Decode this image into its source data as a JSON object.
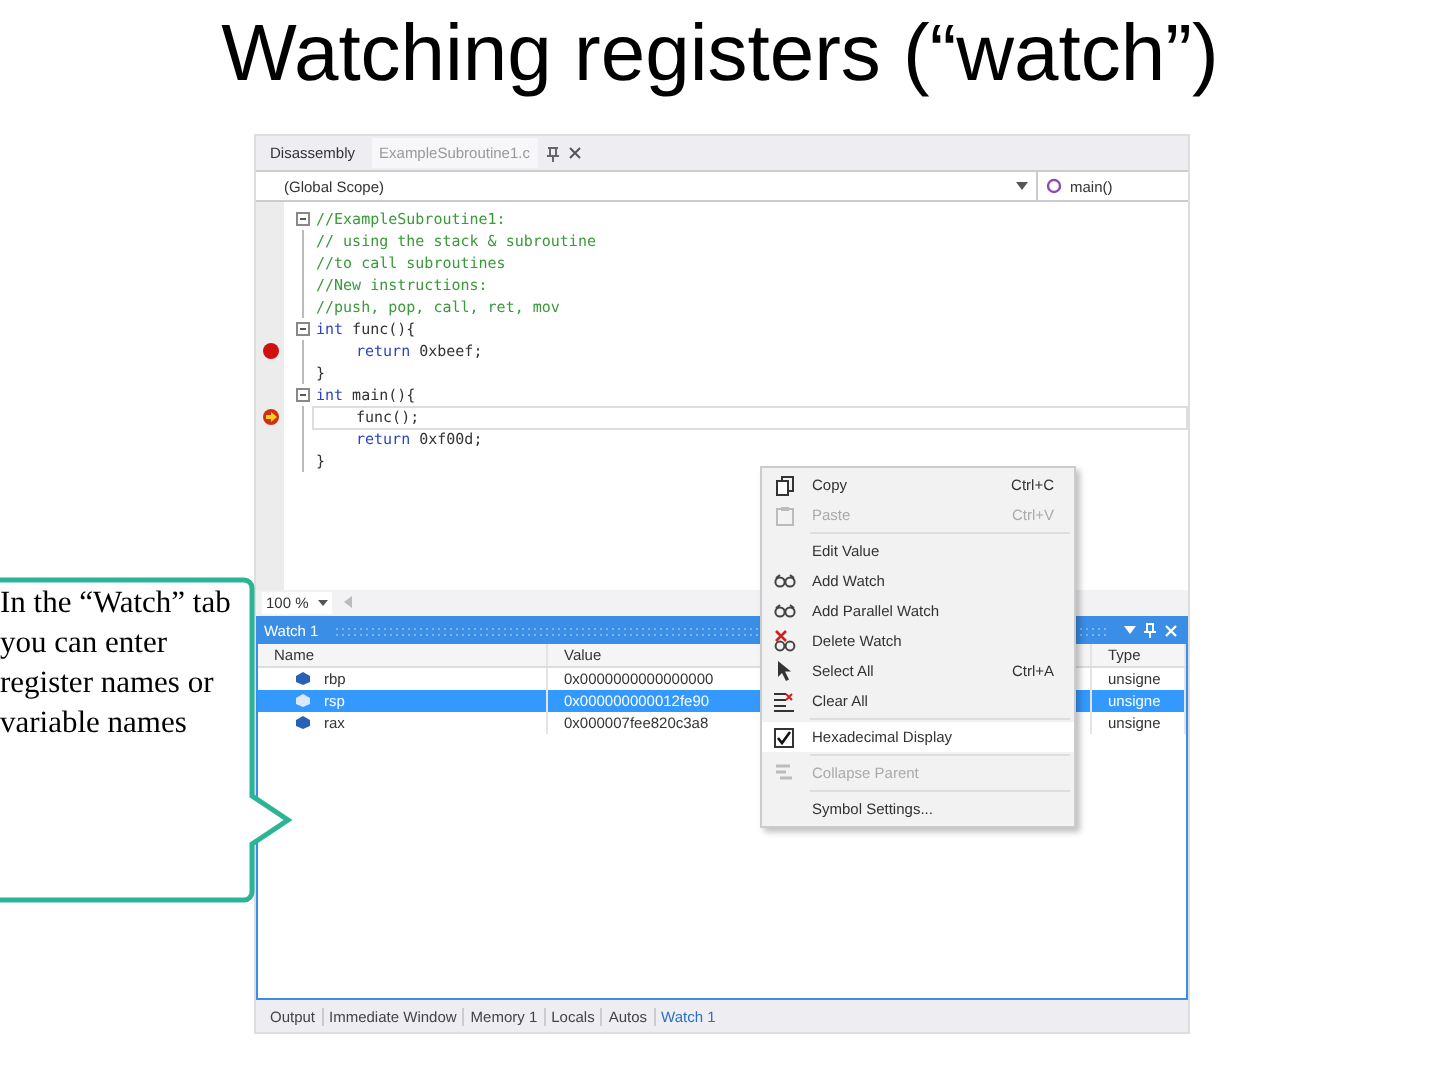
{
  "slide": {
    "title": "Watching registers (“watch”)"
  },
  "callout": {
    "text": "In the “Watch” tab you can enter register names or variable names"
  },
  "editor": {
    "tabs": [
      {
        "label": "Disassembly",
        "selected": false
      },
      {
        "label": "ExampleSubroutine1.c",
        "selected": true
      }
    ],
    "scope": "(Global Scope)",
    "member": "main()",
    "zoom": "100 %",
    "lines": [
      {
        "fold": true,
        "current": false,
        "tokens": [
          {
            "kind": "comment",
            "text": "//ExampleSubroutine1:"
          }
        ]
      },
      {
        "fold": false,
        "current": false,
        "tokens": [
          {
            "kind": "comment",
            "text": "// using the stack & subroutine"
          }
        ]
      },
      {
        "fold": false,
        "current": false,
        "tokens": [
          {
            "kind": "comment",
            "text": "//to call subroutines"
          }
        ]
      },
      {
        "fold": false,
        "current": false,
        "tokens": [
          {
            "kind": "comment",
            "text": "//New instructions:"
          }
        ]
      },
      {
        "fold": false,
        "current": false,
        "tokens": [
          {
            "kind": "comment",
            "text": "//push, pop, call, ret, mov"
          }
        ]
      },
      {
        "fold": true,
        "current": false,
        "tokens": [
          {
            "kind": "keyword",
            "text": "int"
          },
          {
            "kind": "plain",
            "text": " func(){"
          }
        ]
      },
      {
        "fold": false,
        "current": false,
        "breakpoint": true,
        "indented": true,
        "tokens": [
          {
            "kind": "keyword",
            "text": "return"
          },
          {
            "kind": "plain",
            "text": " 0xbeef;"
          }
        ]
      },
      {
        "fold": false,
        "current": false,
        "tokens": [
          {
            "kind": "plain",
            "text": "}"
          }
        ]
      },
      {
        "fold": true,
        "current": false,
        "tokens": [
          {
            "kind": "keyword",
            "text": "int"
          },
          {
            "kind": "plain",
            "text": " main(){"
          }
        ]
      },
      {
        "fold": false,
        "current": true,
        "breakpoint": true,
        "indented": true,
        "tokens": [
          {
            "kind": "plain",
            "text": "func();"
          }
        ]
      },
      {
        "fold": false,
        "current": false,
        "indented": true,
        "tokens": [
          {
            "kind": "keyword",
            "text": "return"
          },
          {
            "kind": "plain",
            "text": " 0xf00d;"
          }
        ]
      },
      {
        "fold": false,
        "current": false,
        "tokens": [
          {
            "kind": "plain",
            "text": "}"
          }
        ]
      }
    ]
  },
  "watch": {
    "title": "Watch 1",
    "columns": [
      "Name",
      "Value",
      "Type"
    ],
    "rows": [
      {
        "name": "rbp",
        "value": "0x0000000000000000",
        "type": "unsigne",
        "selected": false
      },
      {
        "name": "rsp",
        "value": "0x000000000012fe90",
        "type": "unsigne",
        "selected": true
      },
      {
        "name": "rax",
        "value": "0x000007fee820c3a8",
        "type": "unsigne",
        "selected": false
      }
    ]
  },
  "context_menu": {
    "items": [
      {
        "kind": "command",
        "label": "Copy",
        "shortcut": "Ctrl+C",
        "disabled": false,
        "selected": false
      },
      {
        "kind": "command",
        "label": "Paste",
        "shortcut": "Ctrl+V",
        "disabled": true,
        "selected": false
      },
      {
        "kind": "separator"
      },
      {
        "kind": "command",
        "label": "Edit Value",
        "disabled": false,
        "selected": false
      },
      {
        "kind": "command",
        "label": "Add Watch",
        "disabled": false,
        "selected": false
      },
      {
        "kind": "command",
        "label": "Add Parallel Watch",
        "disabled": false,
        "selected": false
      },
      {
        "kind": "command",
        "label": "Delete Watch",
        "disabled": false,
        "selected": false
      },
      {
        "kind": "command",
        "label": "Select All",
        "shortcut": "Ctrl+A",
        "disabled": false,
        "selected": false
      },
      {
        "kind": "command",
        "label": "Clear All",
        "disabled": false,
        "selected": false
      },
      {
        "kind": "separator"
      },
      {
        "kind": "check",
        "label": "Hexadecimal Display",
        "checked": true,
        "disabled": false,
        "selected": true
      },
      {
        "kind": "separator"
      },
      {
        "kind": "command",
        "label": "Collapse Parent",
        "disabled": true,
        "selected": false
      },
      {
        "kind": "separator"
      },
      {
        "kind": "command",
        "label": "Symbol Settings...",
        "disabled": false,
        "selected": false
      }
    ]
  },
  "bottom_tabs": [
    {
      "label": "Output",
      "selected": false
    },
    {
      "label": "Immediate Window",
      "selected": false
    },
    {
      "label": "Memory 1",
      "selected": false
    },
    {
      "label": "Locals",
      "selected": false
    },
    {
      "label": "Autos",
      "selected": false
    },
    {
      "label": "Watch 1",
      "selected": true
    }
  ]
}
